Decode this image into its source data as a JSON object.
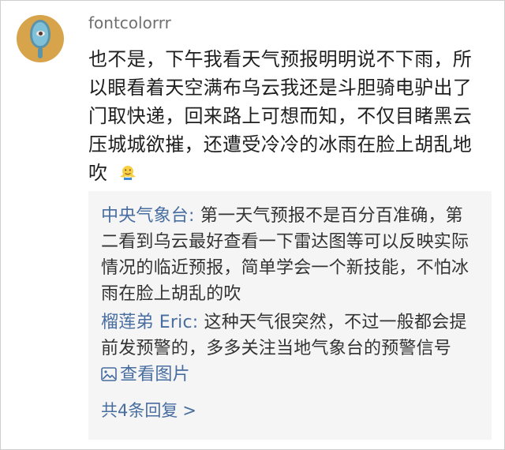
{
  "post": {
    "username": "fontcolorrr",
    "avatar_icon": "mirror-eye-avatar",
    "text": "也不是，下午我看天气预报明明说不下雨，所以眼看着天空满布乌云我还是斗胆骑电驴出了门取快递，回来路上可想而知，不仅目睹黑云压城城欲摧，还遭受冷冷的冰雨在脸上胡乱地吹",
    "emoji_icon": "shrug-emoji"
  },
  "replies": [
    {
      "author": "中央气象台:",
      "text": " 第一天气预报不是百分百准确，第二看到乌云最好查看一下雷达图等可以反映实际情况的临近预报，简单学会一个新技能，不怕冰雨在脸上胡乱的吹"
    },
    {
      "author": "榴莲弟 Eric:",
      "text": " 这种天气很突然，不过一般都会提前发预警的，多多关注当地气象台的预警信号",
      "link_label": "查看图片",
      "link_icon": "image-icon"
    }
  ],
  "footer": {
    "total_replies": "共4条回复",
    "chevron": ">"
  },
  "colors": {
    "link": "#486da0",
    "reply_bg": "#f5f5f5",
    "username": "#6f6f6f"
  }
}
